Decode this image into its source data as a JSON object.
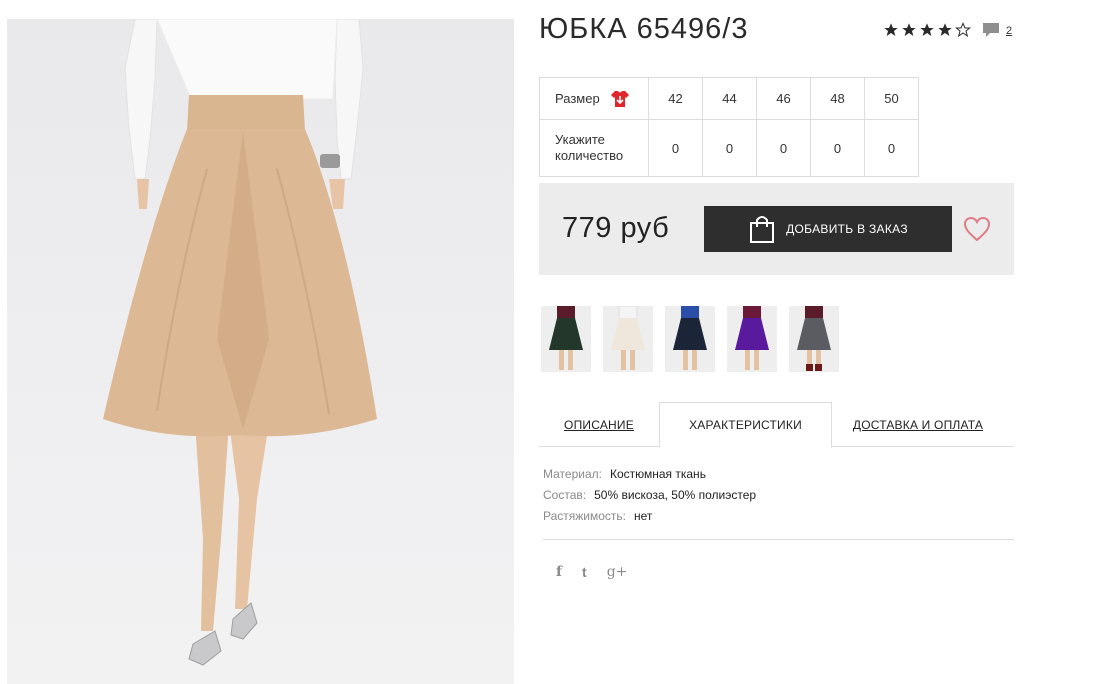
{
  "product": {
    "title": "ЮБКА 65496/3",
    "rating_value": 4,
    "rating_max": 5,
    "reviews_count": "2",
    "price": "779 руб"
  },
  "size_table": {
    "size_label": "Размер",
    "qty_label_line1": "Укажите",
    "qty_label_line2": "количество",
    "sizes": [
      "42",
      "44",
      "46",
      "48",
      "50"
    ],
    "quantities": [
      "0",
      "0",
      "0",
      "0",
      "0"
    ]
  },
  "actions": {
    "add_to_order": "ДОБАВИТЬ В ЗАКАЗ"
  },
  "thumbnails": [
    {
      "skirt_color": "#23372b",
      "top_color": "#5a1c2a"
    },
    {
      "skirt_color": "#efe6dc",
      "top_color": "#f4f4f4"
    },
    {
      "skirt_color": "#1c2438",
      "top_color": "#2b4fa8"
    },
    {
      "skirt_color": "#5a1a9e",
      "top_color": "#6b1a3a"
    },
    {
      "skirt_color": "#5a5c62",
      "top_color": "#5a1c2a"
    }
  ],
  "tabs": {
    "description": "ОПИСАНИЕ",
    "characteristics": "ХАРАКТЕРИСТИКИ",
    "delivery": "ДОСТАВКА И ОПЛАТА"
  },
  "specs": [
    {
      "key": "Материал:",
      "value": "Костюмная ткань"
    },
    {
      "key": "Состав:",
      "value": "50% вискоза, 50% полиэстер"
    },
    {
      "key": "Растяжимость:",
      "value": "нет"
    }
  ],
  "social": {
    "facebook": "f",
    "twitter": "t",
    "google_plus": "g+"
  },
  "colors": {
    "button_bg": "#2e2e2e",
    "panel_bg": "#ececec",
    "size_icon": "#e3262b",
    "heart": "#e07a86",
    "skirt": "#dcb894"
  }
}
